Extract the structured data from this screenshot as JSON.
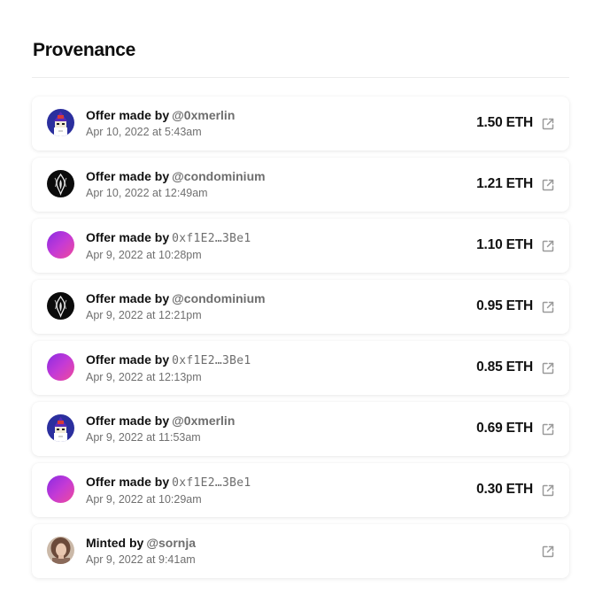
{
  "provenance": {
    "title": "Provenance",
    "events": [
      {
        "action": "Offer made by",
        "actor": "@0xmerlin",
        "actor_style": "handle",
        "avatar": "wizard-avatar",
        "date": "Apr 10, 2022 at 5:43am",
        "price": "1.50 ETH"
      },
      {
        "action": "Offer made by",
        "actor": "@condominium",
        "actor_style": "handle",
        "avatar": "flame-avatar",
        "date": "Apr 10, 2022 at 12:49am",
        "price": "1.21 ETH"
      },
      {
        "action": "Offer made by",
        "actor": "0xf1E2…3Be1",
        "actor_style": "address",
        "avatar": "gradient-avatar",
        "date": "Apr 9, 2022 at 10:28pm",
        "price": "1.10 ETH"
      },
      {
        "action": "Offer made by",
        "actor": "@condominium",
        "actor_style": "handle",
        "avatar": "flame-avatar",
        "date": "Apr 9, 2022 at 12:21pm",
        "price": "0.95 ETH"
      },
      {
        "action": "Offer made by",
        "actor": "0xf1E2…3Be1",
        "actor_style": "address",
        "avatar": "gradient-avatar",
        "date": "Apr 9, 2022 at 12:13pm",
        "price": "0.85 ETH"
      },
      {
        "action": "Offer made by",
        "actor": "@0xmerlin",
        "actor_style": "handle",
        "avatar": "wizard-avatar",
        "date": "Apr 9, 2022 at 11:53am",
        "price": "0.69 ETH"
      },
      {
        "action": "Offer made by",
        "actor": "0xf1E2…3Be1",
        "actor_style": "address",
        "avatar": "gradient-avatar",
        "date": "Apr 9, 2022 at 10:29am",
        "price": "0.30 ETH"
      },
      {
        "action": "Minted by",
        "actor": "@sornja",
        "actor_style": "handle",
        "avatar": "portrait-avatar",
        "date": "Apr 9, 2022 at 9:41am",
        "price": ""
      }
    ],
    "link_icon": "external-link-icon",
    "colors": {
      "text_primary": "#111111",
      "text_secondary": "#6e6e6e",
      "gradient_start": "#8a2be2",
      "gradient_end": "#ef4a9b",
      "wizard_bg": "#2b2f9e"
    }
  }
}
